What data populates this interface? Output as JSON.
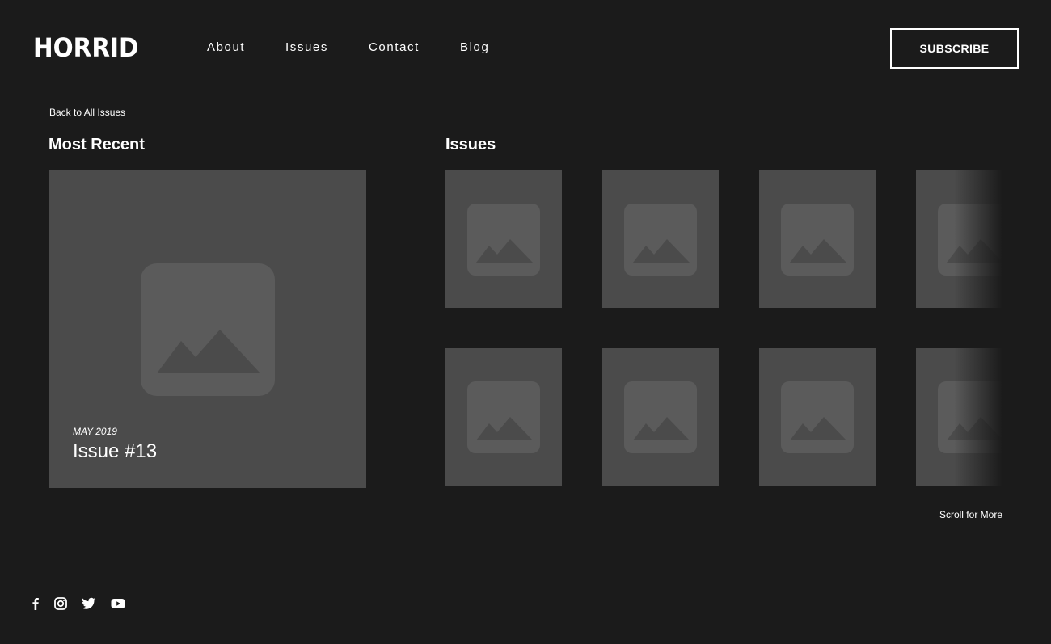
{
  "header": {
    "logo": "HORRID",
    "nav": [
      "About",
      "Issues",
      "Contact",
      "Blog"
    ],
    "subscribe_label": "SUBSCRIBE"
  },
  "back_link": "Back to All Issues",
  "most_recent": {
    "title": "Most Recent",
    "date": "MAY 2019",
    "issue_title": "Issue #13"
  },
  "issues": {
    "title": "Issues",
    "scroll_hint": "Scroll for More"
  },
  "social": {
    "icons": [
      "facebook-icon",
      "instagram-icon",
      "twitter-icon",
      "youtube-icon"
    ]
  },
  "colors": {
    "background": "#1b1b1b",
    "tile": "#4b4b4b",
    "placeholder": "#5b5b5b",
    "text": "#ffffff"
  }
}
